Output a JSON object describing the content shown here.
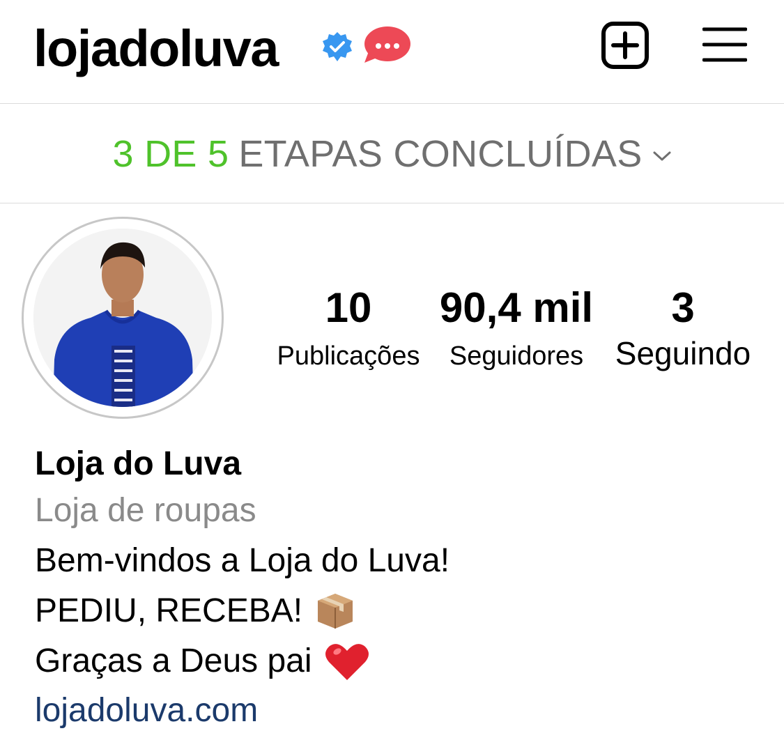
{
  "header": {
    "username": "lojadoluva",
    "icons": [
      "verified-badge-icon",
      "message-bubble-icon",
      "new-post-icon",
      "menu-icon"
    ]
  },
  "steps": {
    "done": "3 DE 5",
    "rest": "ETAPAS CONCLUÍDAS",
    "completed": 3,
    "total": 5
  },
  "stats": [
    {
      "value": "10",
      "label": "Publicações"
    },
    {
      "value": "90,4 mil",
      "label": "Seguidores"
    },
    {
      "value": "3",
      "label": "Seguindo"
    }
  ],
  "bio": {
    "name": "Loja do Luva",
    "category": "Loja de roupas",
    "line1": "Bem-vindos a Loja do Luva!",
    "line2": "PEDIU, RECEBA!",
    "line3": "Graças a Deus pai",
    "link": "lojadoluva.com"
  },
  "colors": {
    "steps_done": "#4fc22b",
    "steps_rest": "#6f6f6f",
    "verified": "#3897f0",
    "dm_bubble": "#ed4956",
    "link": "#1b3a6b",
    "category": "#8a8a8a"
  }
}
